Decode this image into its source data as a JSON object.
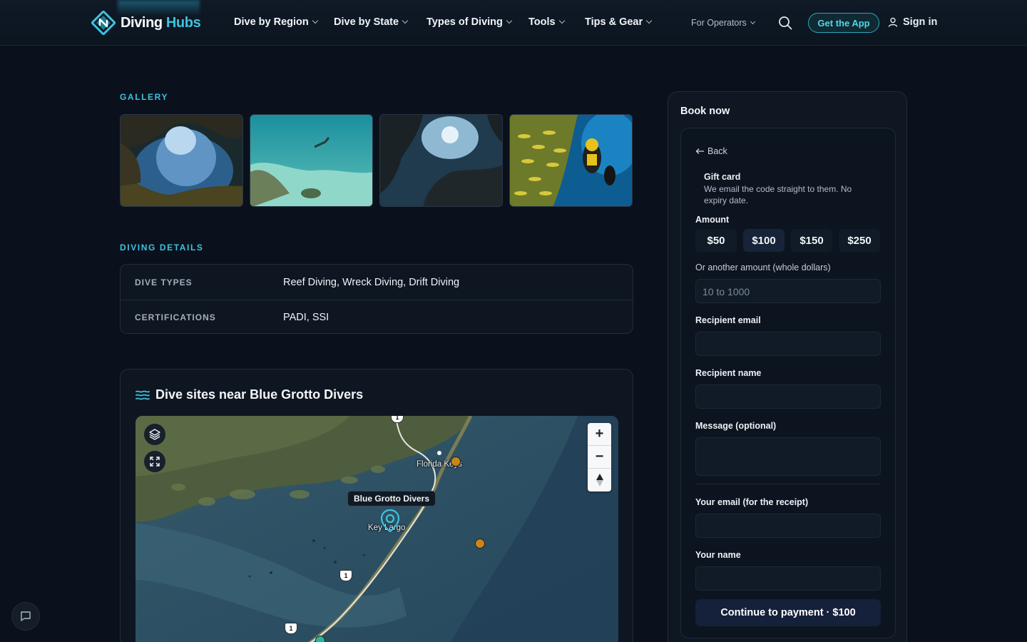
{
  "nav": {
    "logo_part1": "Diving",
    "logo_part2": "Hubs",
    "items": [
      "Dive by Region",
      "Dive by State",
      "Types of Diving",
      "Tools",
      "Tips & Gear"
    ],
    "operators": "For Operators",
    "get_app": "Get the App",
    "sign_in": "Sign in"
  },
  "gallery": {
    "label": "GALLERY",
    "images": [
      "underwater-cave-photo",
      "snorkeler-reef-photo",
      "dark-reef-photo",
      "diver-fish-school-photo"
    ]
  },
  "details": {
    "label": "DIVING DETAILS",
    "rows": [
      {
        "key": "DIVE TYPES",
        "value": "Reef Diving, Wreck Diving, Drift Diving"
      },
      {
        "key": "CERTIFICATIONS",
        "value": "PADI, SSI"
      }
    ]
  },
  "map": {
    "title": "Dive sites near Blue Grotto Divers",
    "marker_label": "Blue Grotto Divers",
    "place_labels": [
      "Florida Keys",
      "Key Largo"
    ],
    "route_markers": [
      "1",
      "1",
      "1"
    ],
    "zoom_in": "+",
    "zoom_out": "−",
    "colors": {
      "site_dot": "#c7861c",
      "pin": "#3ec3dd",
      "teal_dot": "#22b8a0"
    }
  },
  "booking": {
    "title": "Book now",
    "back": "Back",
    "gift_title": "Gift card",
    "gift_desc": "We email the code straight to them. No expiry date.",
    "amount_label": "Amount",
    "amounts": [
      "$50",
      "$100",
      "$150",
      "$250"
    ],
    "selected_amount": "$100",
    "other_amount_label": "Or another amount (whole dollars)",
    "other_amount_placeholder": "10 to 1000",
    "recipient_email_label": "Recipient email",
    "recipient_name_label": "Recipient name",
    "message_label": "Message (optional)",
    "your_email_label": "Your email (for the receipt)",
    "your_name_label": "Your name",
    "pay_button": "Continue to payment · $100"
  },
  "theme": {
    "accent": "#3ec3dd",
    "background": "#0a111d"
  }
}
